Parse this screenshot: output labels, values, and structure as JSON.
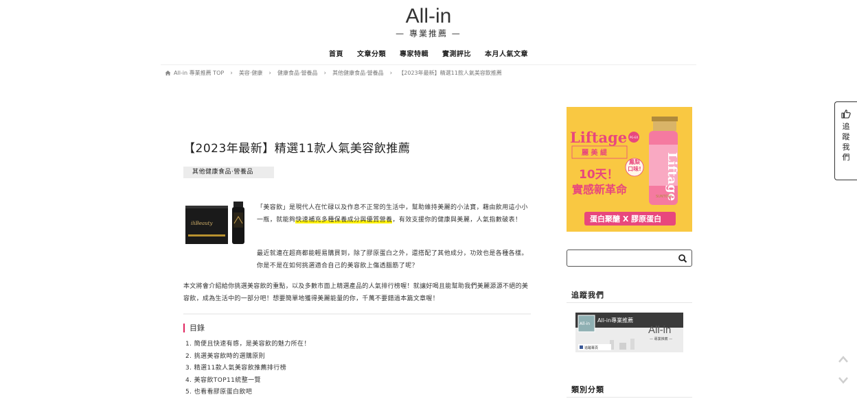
{
  "header": {
    "logo_main": "All-in",
    "logo_sub": "— 專業推薦 —"
  },
  "nav": {
    "items": [
      {
        "label": "首頁"
      },
      {
        "label": "文章分類"
      },
      {
        "label": "專家特輯"
      },
      {
        "label": "實測評比"
      },
      {
        "label": "本月人氣文章"
      }
    ]
  },
  "breadcrumb": {
    "items": [
      {
        "label": "All-in 專業推薦 TOP"
      },
      {
        "label": "美容‧健康"
      },
      {
        "label": "健康食品‧營養品"
      },
      {
        "label": "其他健康食品‧營養品"
      },
      {
        "label": "【2023年最新】精選11款人氣美容飲推薦"
      }
    ]
  },
  "article": {
    "title": "【2023年最新】精選11款人氣美容飲推薦",
    "category_tag": "其他健康食品‧營養品",
    "intro_p1_a": "「美容飲」是現代人在忙碌以及作息不正常的生活中，幫助維持美麗的小法寶，藉由飲用這小小一瓶，就能夠",
    "intro_p1_highlight": "快速補充多種保養成分與優質營養",
    "intro_p1_b": "，有效支援你的健康與美麗，人氣指數破表！",
    "intro_p2": "最近就連在超商都能輕易購買到，除了膠原蛋白之外，還搭配了其他成分，功效也是各種各樣。你是不是在如何挑選適合自己的美容飲上傷透腦筋了呢？",
    "summary": "本文將會介紹給你挑選美容飲的重點，以及多數市面上精選產品的人氣排行榜喔！就讓好喝且能幫助我們美麗源源不絕的美容飲，成為生活中的一部分吧！想要簡單地獲得美麗能量的你，千萬不要錯過本篇文章喔！"
  },
  "toc": {
    "title": "目錄",
    "items": [
      {
        "label": "1. 簡便且快速有感，是美容飲的魅力所在！"
      },
      {
        "label": "2. 挑選美容飲時的選購原則"
      },
      {
        "label": "3. 精選11款人氣美容飲推薦排行榜"
      },
      {
        "label": "4. 美容飲TOP11統整一覽"
      },
      {
        "label": "5. 也看看膠原蛋白飲吧"
      }
    ]
  },
  "sidebar": {
    "ad": {
      "brand": "Liftage",
      "brand_badge": "PG-EX",
      "brand_cn": "麗 美 緹",
      "flavor": "鳳梨口味!",
      "headline1": "10天！",
      "headline2": "實感新革命",
      "footer": "蛋白聚醣 X 膠原蛋白",
      "bottle_text": "Liftage",
      "bottle_maker": "SUNTORY"
    },
    "search": {
      "placeholder": ""
    },
    "follow_heading": "追蹤我們",
    "fb_page_name": "All-in專業推薦",
    "fb_logo_text": "All-in",
    "fb_logo_sub": "— 專業推薦 —",
    "fb_follow_label": "追蹤專頁",
    "category_heading": "類別分類"
  },
  "follow_tab": {
    "chars": [
      "追",
      "蹤",
      "我",
      "們"
    ]
  },
  "colors": {
    "accent": "#e0245e",
    "highlight": "#fff200",
    "ad_bg": "#f9c842",
    "ad_pink": "#e8477d"
  }
}
